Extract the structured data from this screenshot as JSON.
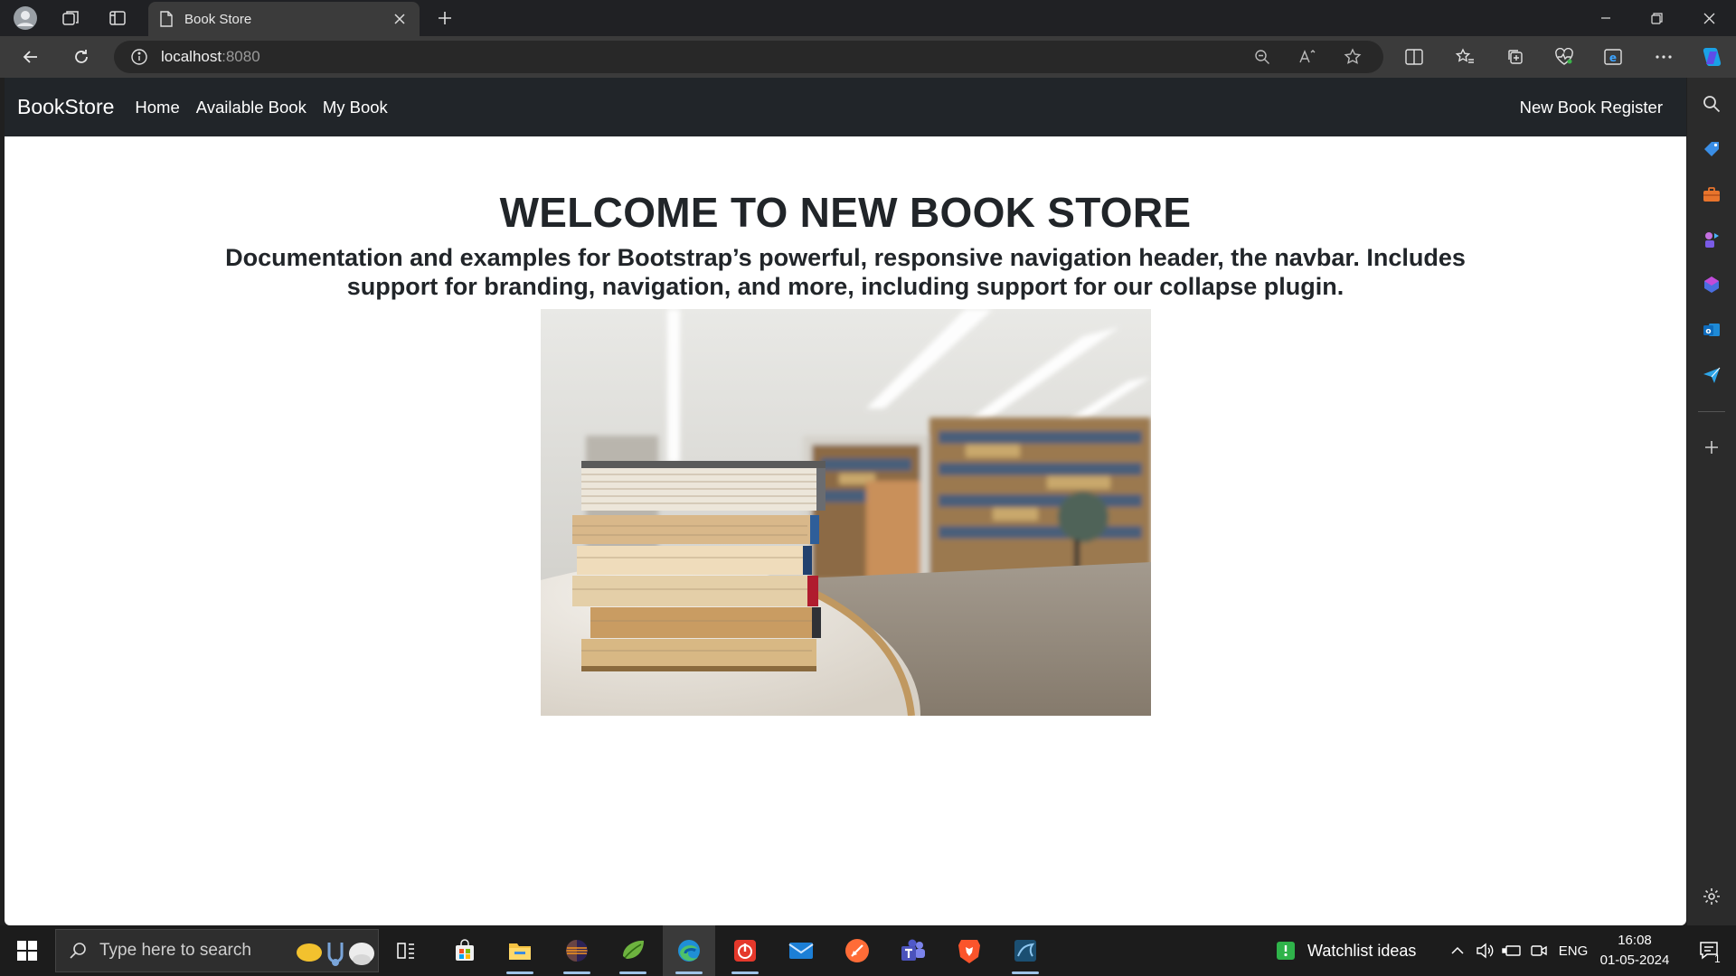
{
  "browser": {
    "tab_title": "Book Store",
    "url_host": "localhost",
    "url_port": ":8080"
  },
  "navbar": {
    "brand": "BookStore",
    "links": [
      "Home",
      "Available Book",
      "My Book"
    ],
    "right_link": "New Book Register",
    "bg_color": "#212529"
  },
  "hero": {
    "title": "WELCOME TO NEW BOOK STORE",
    "subtitle": "Documentation and examples for Bootstrap’s powerful, responsive navigation header, the navbar. Includes support for branding, navigation, and more, including support for our collapse plugin."
  },
  "taskbar": {
    "search_placeholder": "Type here to search",
    "widget_label": "Watchlist ideas",
    "language": "ENG",
    "time": "16:08",
    "date": "01-05-2024",
    "notification_count": "1"
  }
}
